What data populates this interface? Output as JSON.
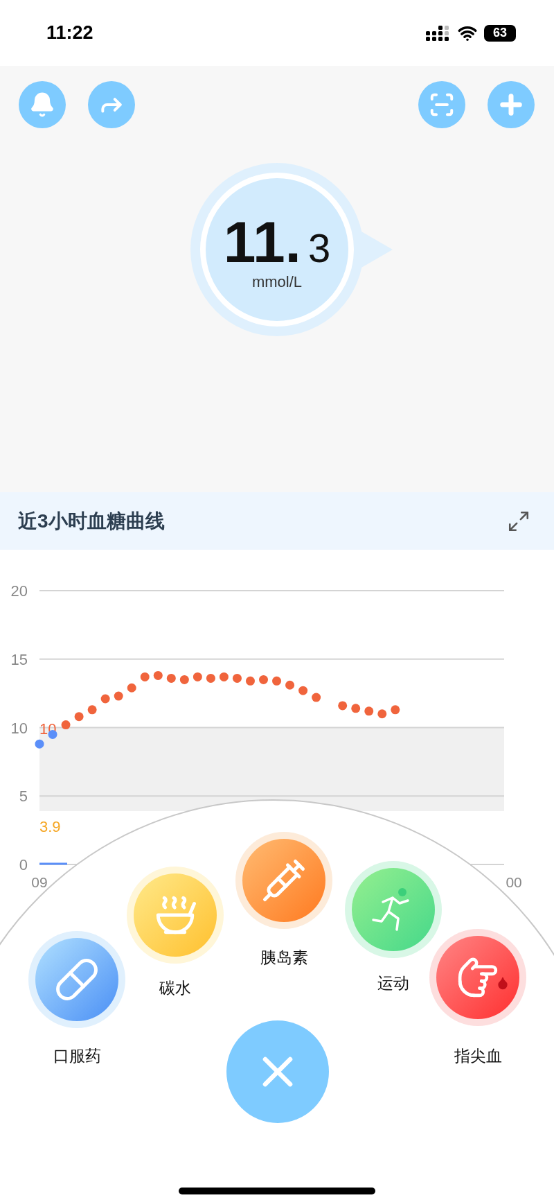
{
  "status_bar": {
    "time": "11:22",
    "battery": "63"
  },
  "reading": {
    "value_integer": "11.",
    "value_decimal": "3",
    "unit": "mmol/L"
  },
  "chart_panel": {
    "title": "近3小时血糖曲线",
    "chart_data": {
      "type": "scatter",
      "categories": [
        "09",
        null,
        null,
        null,
        null,
        null,
        null,
        null,
        null,
        null,
        null,
        null,
        null,
        null,
        null,
        null,
        null,
        null,
        null,
        null,
        null,
        null,
        null,
        null,
        null,
        null,
        null,
        null,
        null,
        null,
        null,
        null,
        null,
        null,
        null,
        null,
        "00"
      ],
      "ylim": [
        0,
        20
      ],
      "yticks": [
        0,
        5,
        10,
        15,
        20
      ],
      "series": [
        {
          "color": "#5b8ff9",
          "values": [
            8.8,
            9.5,
            null,
            null,
            null,
            null,
            null,
            null,
            null,
            null,
            null,
            null,
            null,
            null,
            null,
            null,
            null,
            null,
            null,
            null,
            null,
            null,
            null,
            null,
            null,
            null,
            null,
            null,
            null,
            null,
            null,
            null,
            null,
            null,
            null,
            null,
            null
          ]
        },
        {
          "color": "#f0643c",
          "values": [
            null,
            null,
            10.2,
            10.8,
            11.3,
            12.1,
            12.3,
            12.9,
            13.7,
            13.8,
            13.6,
            13.5,
            13.7,
            13.6,
            13.7,
            13.6,
            13.4,
            13.5,
            13.4,
            13.1,
            12.7,
            12.2,
            null,
            11.6,
            11.4,
            11.2,
            11.0,
            11.3,
            null,
            null,
            null,
            null,
            null,
            null,
            null,
            null,
            null
          ]
        }
      ],
      "bands": [
        {
          "axis": "y",
          "from": 3.9,
          "to": 10
        }
      ],
      "grid": true
    },
    "range_labels": [
      {
        "label": "10",
        "color": "#f0643c"
      },
      {
        "label": "3.9",
        "color": "#f5a623"
      }
    ]
  },
  "quick_menu": {
    "items": [
      {
        "kind": "medicine",
        "label": "口服药"
      },
      {
        "kind": "carbs",
        "label": "碳水"
      },
      {
        "kind": "insulin",
        "label": "胰岛素"
      },
      {
        "kind": "exercise",
        "label": "运动"
      },
      {
        "kind": "fingertip",
        "label": "指尖血"
      }
    ]
  }
}
